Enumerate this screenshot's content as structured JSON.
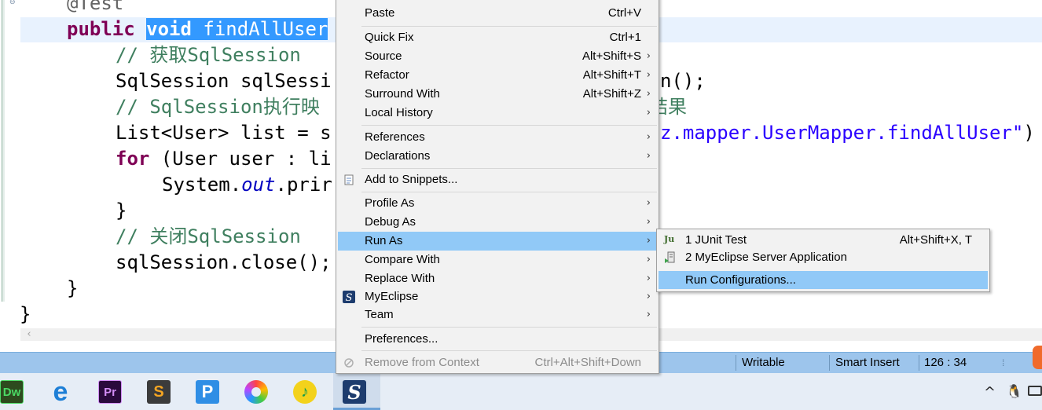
{
  "editor": {
    "lines": [
      {
        "indent": "    ",
        "ann": "@Test"
      },
      {
        "kw": "public",
        "sel_kw": "void",
        "sel_text": " findAllUser"
      },
      {
        "comment": "// 获取SqlSession"
      },
      {
        "left": "SqlSession sqlSessi",
        "right": "n();"
      },
      {
        "comment_left": "// SqlSession执行映",
        "comment_right": "结果"
      },
      {
        "left": "List<User> list = s",
        "string_right": "z.mapper.UserMapper.findAllUser\"",
        "tail": ")"
      },
      {
        "kw": "for",
        "rest": " (User user : li"
      },
      {
        "left": "System.",
        "field": "out",
        "rest": ".prir"
      },
      {
        "text": "}"
      },
      {
        "comment": "// 关闭SqlSession"
      },
      {
        "text": "sqlSession.close();"
      },
      {
        "text": "}"
      },
      {
        "text": "}"
      }
    ]
  },
  "context_menu": {
    "items": [
      {
        "label": "Paste",
        "shortcut": "Ctrl+V"
      },
      {
        "label": "Quick Fix",
        "shortcut": "Ctrl+1"
      },
      {
        "label": "Source",
        "shortcut": "Alt+Shift+S"
      },
      {
        "label": "Refactor",
        "shortcut": "Alt+Shift+T"
      },
      {
        "label": "Surround With",
        "shortcut": "Alt+Shift+Z"
      },
      {
        "label": "Local History",
        "shortcut": ""
      },
      {
        "label": "References",
        "shortcut": ""
      },
      {
        "label": "Declarations",
        "shortcut": ""
      },
      {
        "label": "Add to Snippets...",
        "shortcut": ""
      },
      {
        "label": "Profile As",
        "shortcut": ""
      },
      {
        "label": "Debug As",
        "shortcut": ""
      },
      {
        "label": "Run As",
        "shortcut": ""
      },
      {
        "label": "Compare With",
        "shortcut": ""
      },
      {
        "label": "Replace With",
        "shortcut": ""
      },
      {
        "label": "MyEclipse",
        "shortcut": ""
      },
      {
        "label": "Team",
        "shortcut": ""
      },
      {
        "label": "Preferences...",
        "shortcut": ""
      },
      {
        "label": "Remove from Context",
        "shortcut": "Ctrl+Alt+Shift+Down"
      }
    ],
    "arrow_glyph": "›"
  },
  "run_as_submenu": {
    "items": [
      {
        "label": "1 JUnit Test",
        "shortcut": "Alt+Shift+X, T",
        "icon": "junit-icon",
        "icon_text": "Ju"
      },
      {
        "label": "2 MyEclipse Server Application",
        "shortcut": "",
        "icon": "server-app-icon"
      },
      {
        "label": "Run Configurations...",
        "shortcut": ""
      }
    ]
  },
  "status_bar": {
    "writable": "Writable",
    "insert_mode": "Smart Insert",
    "position": "126 : 34"
  },
  "taskbar": {
    "apps": [
      {
        "name": "dreamweaver-icon",
        "text": "Dw",
        "bg": "#2d4b1e",
        "fg": "#4bd964"
      },
      {
        "name": "edge-icon",
        "text": "e",
        "bg": "transparent",
        "fg": "#1e7fd6"
      },
      {
        "name": "premiere-icon",
        "text": "Pr",
        "bg": "#2a0a3d",
        "fg": "#d28df5"
      },
      {
        "name": "sublime-icon",
        "text": "S",
        "bg": "#3b3b3b",
        "fg": "#f5a623"
      },
      {
        "name": "p-app-icon",
        "text": "P",
        "bg": "#2f8ee5",
        "fg": "#ffffff"
      },
      {
        "name": "color-wheel-icon",
        "text": "",
        "bg": "transparent",
        "fg": ""
      },
      {
        "name": "music-icon",
        "text": "♪",
        "bg": "#f3d21c",
        "fg": "#1a9f4a"
      },
      {
        "name": "myeclipse-icon",
        "text": "S",
        "bg": "#1d3c6e",
        "fg": "#ffffff"
      }
    ],
    "tray": {
      "chevron": "^",
      "qq": "🐧"
    }
  },
  "colors": {
    "menu_highlight": "#91c9f7",
    "status_bar": "#9dc5ec",
    "selection": "#3399ff",
    "keyword": "#7f0055",
    "comment": "#3f7f5f",
    "string": "#2a00ff"
  }
}
